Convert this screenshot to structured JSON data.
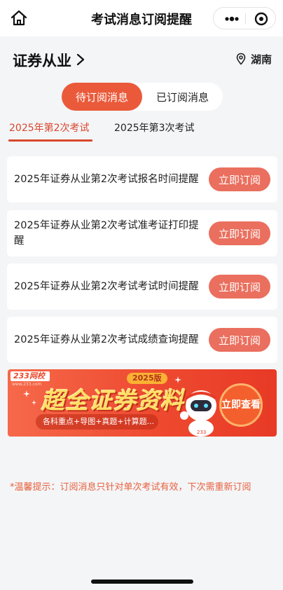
{
  "navbar": {
    "title": "考试消息订阅提醒",
    "home_icon": "home-icon",
    "more_icon": "more-dots-icon",
    "close_icon": "target-circle-icon"
  },
  "header": {
    "category": "证券从业",
    "location": "湖南"
  },
  "segment": {
    "active": "待订阅消息",
    "inactive": "已订阅消息"
  },
  "exam_tabs": [
    {
      "label": "2025年第2次考试",
      "active": true
    },
    {
      "label": "2025年第3次考试",
      "active": false
    }
  ],
  "items": [
    {
      "text": "2025年证券从业第2次考试报名时间提醒",
      "button": "立即订阅"
    },
    {
      "text": "2025年证券从业第2次考试准考证打印提醒",
      "button": "立即订阅"
    },
    {
      "text": "2025年证券从业第2次考试考试时间提醒",
      "button": "立即订阅"
    },
    {
      "text": "2025年证券从业第2次考试成绩查询提醒",
      "button": "立即订阅"
    }
  ],
  "banner": {
    "logo": "233网校",
    "logo_sub": "www.233.com",
    "badge": "2025版",
    "title": "超全证券资料",
    "subtitle": "各科重点+导图+真题+计算题...",
    "cta": "立即查看",
    "robot_label": "233"
  },
  "tip": "*温馨提示：订阅消息只针对单次考试有效，下次需重新订阅",
  "colors": {
    "accent": "#ea5a3a",
    "button": "#ea6f5e",
    "tab_active": "#d9472c",
    "tip": "#e8603e"
  }
}
